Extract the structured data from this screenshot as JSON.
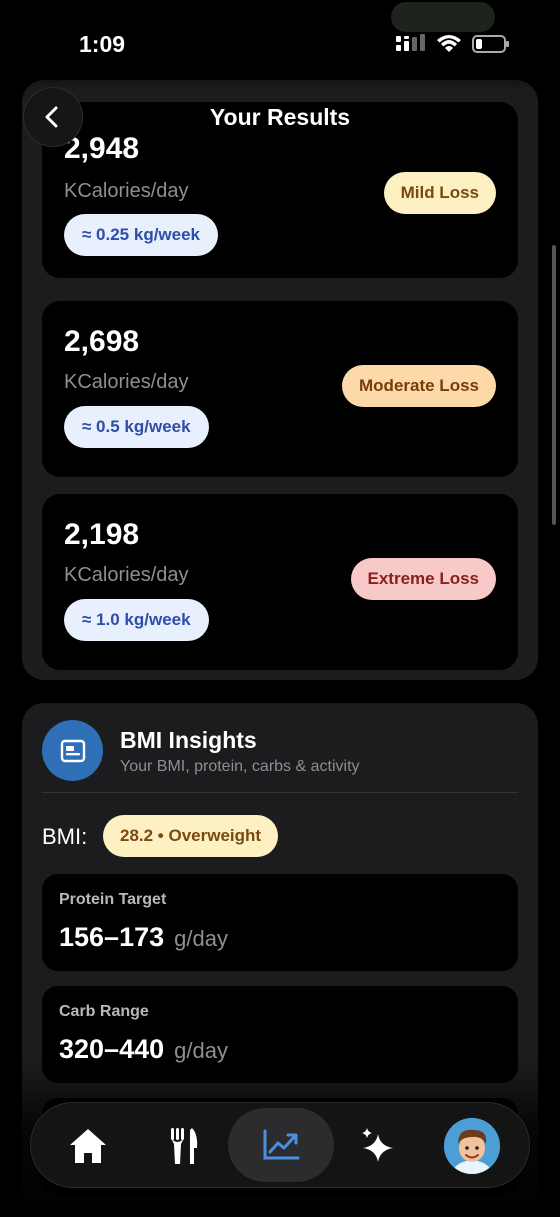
{
  "status_bar": {
    "time": "1:09"
  },
  "header": {
    "title": "Your Results"
  },
  "plans": [
    {
      "kcal": "2,948",
      "unit": "KCalories/day",
      "rate": "≈ 0.25 kg/week",
      "label": "Mild Loss",
      "label_bg": "#fdf1c4",
      "label_color": "#7a4a10"
    },
    {
      "kcal": "2,698",
      "unit": "KCalories/day",
      "rate": "≈ 0.5 kg/week",
      "label": "Moderate Loss",
      "label_bg": "#fcd9a8",
      "label_color": "#7a3d0c"
    },
    {
      "kcal": "2,198",
      "unit": "KCalories/day",
      "rate": "≈ 1.0 kg/week",
      "label": "Extreme Loss",
      "label_bg": "#f8c9c9",
      "label_color": "#8a2020"
    }
  ],
  "bmi": {
    "title": "BMI Insights",
    "subtitle": "Your BMI, protein, carbs & activity",
    "label": "BMI:",
    "badge": "28.2 • Overweight",
    "metrics": [
      {
        "label": "Protein Target",
        "value": "156–173",
        "unit": "g/day"
      },
      {
        "label": "Carb Range",
        "value": "320–440",
        "unit": "g/day"
      }
    ]
  },
  "tabs": [
    {
      "name": "home-icon"
    },
    {
      "name": "fork-knife-icon"
    },
    {
      "name": "chart-trend-icon",
      "active": true
    },
    {
      "name": "sparkles-icon"
    },
    {
      "name": "avatar-icon"
    }
  ],
  "colors": {
    "accent": "#4a90e2",
    "panel": "#1c1c1e",
    "rate_pill": "#e8f0fe"
  }
}
